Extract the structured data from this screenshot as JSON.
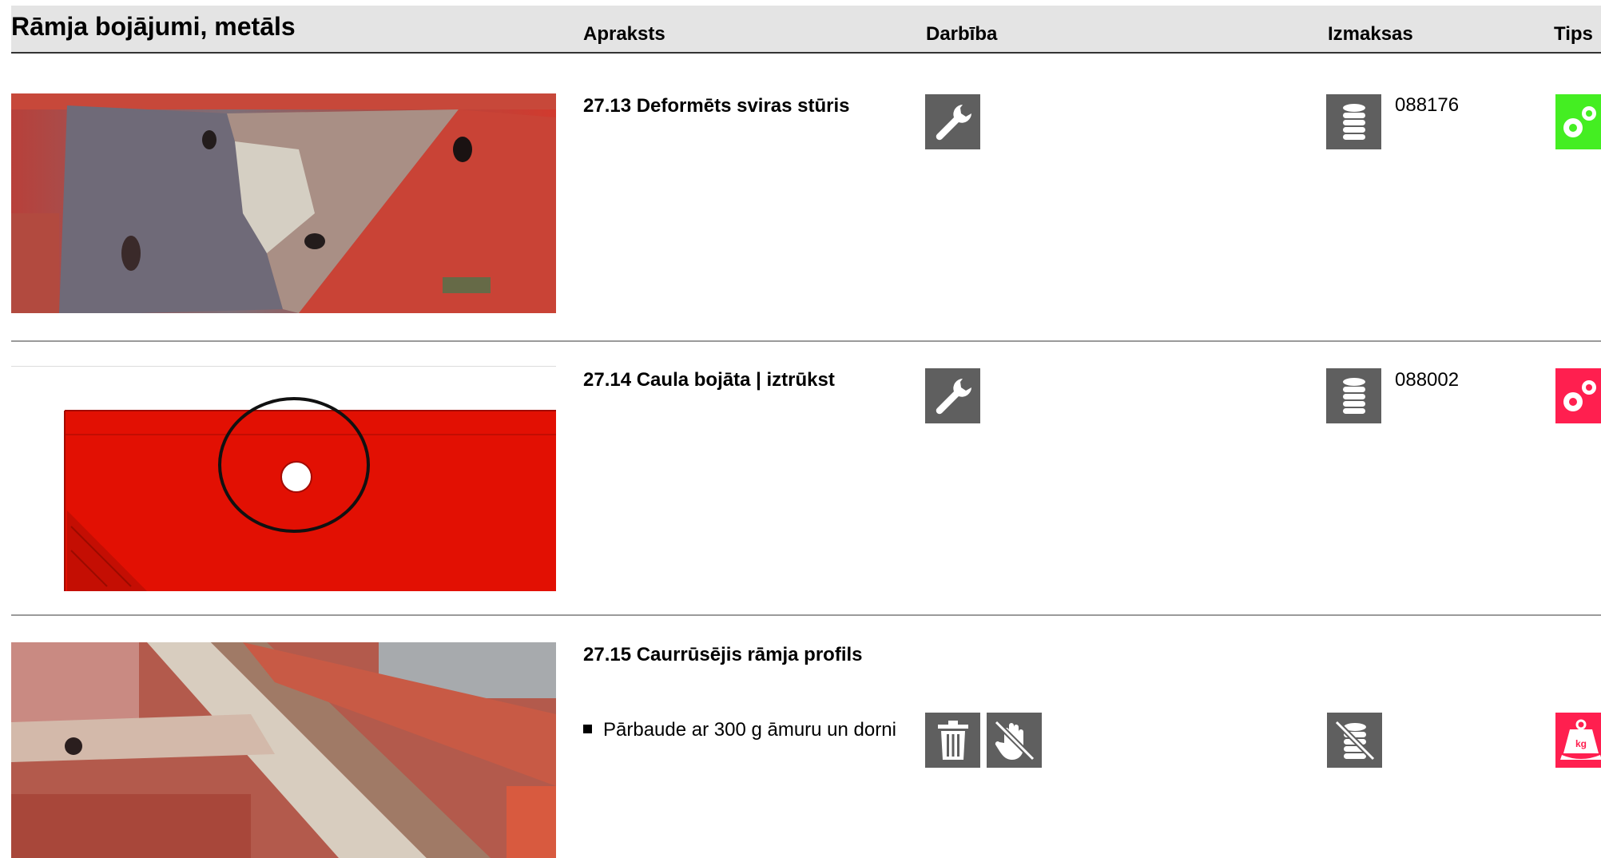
{
  "header": {
    "title": "Rāmja bojājumi, metāls",
    "col_description": "Apraksts",
    "col_action": "Darbība",
    "col_cost": "Izmaksas",
    "col_type": "Tips"
  },
  "rows": [
    {
      "description": "27.13 Deformēts sviras stūris",
      "actions": [
        "wrench-icon"
      ],
      "cost_icon": "coins-icon",
      "cost_code": "088176",
      "type_icon": "gears-icon",
      "type_color": "#44ee22"
    },
    {
      "description": "27.14 Caula bojāta | iztrūkst",
      "actions": [
        "wrench-icon"
      ],
      "cost_icon": "coins-icon",
      "cost_code": "088002",
      "type_icon": "gears-icon",
      "type_color": "#ff1f4f"
    },
    {
      "description": "27.15 Caurrūsējis rāmja profils",
      "bullet": "Pārbaude ar 300 g āmuru un dorni",
      "actions": [
        "trash-icon",
        "no-touch-icon"
      ],
      "cost_icon": "no-cost-icon",
      "type_icon": "weight-icon",
      "type_color": "#ff1f4f"
    }
  ],
  "colors": {
    "header_bg": "#e4e4e4",
    "icon_bg": "#5f5f5f",
    "green": "#44ee22",
    "red": "#ff1f4f"
  }
}
